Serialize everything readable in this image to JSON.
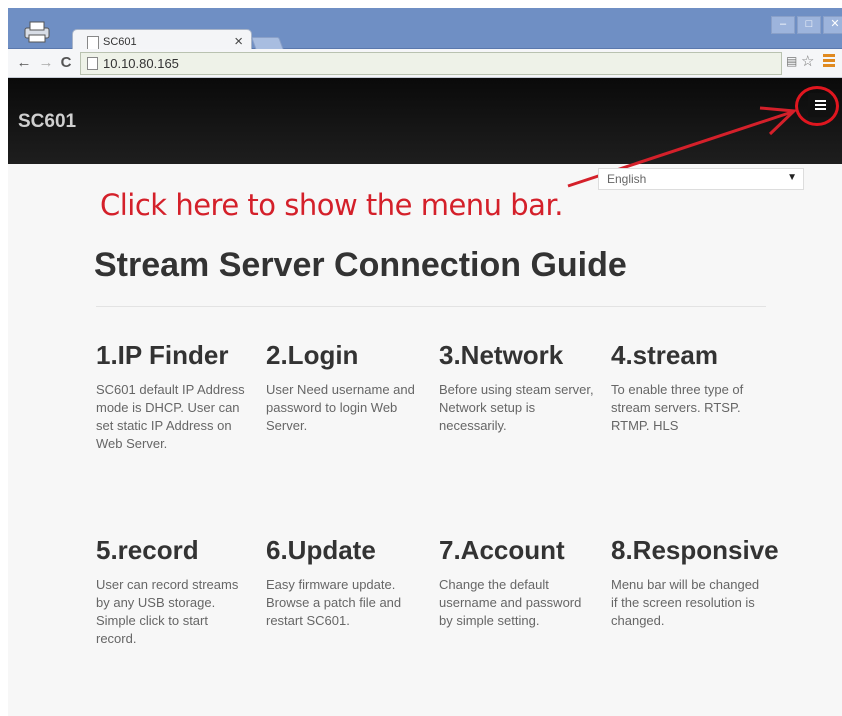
{
  "browser": {
    "tab_title": "SC601",
    "tab_close": "×",
    "url": "10.10.80.165",
    "back": "←",
    "forward": "→",
    "reload": "C",
    "win_min": "–",
    "win_max": "□",
    "win_close": "✕"
  },
  "navbar": {
    "brand": "SC601"
  },
  "language": {
    "selected": "English"
  },
  "annotation": {
    "text": "Click here to show the menu bar.",
    "color": "#d4202a"
  },
  "main": {
    "title": "Stream Server Connection Guide",
    "steps": [
      {
        "heading": "1.IP Finder",
        "text": "SC601 default IP Address mode is DHCP. User can set static IP Address on Web Server."
      },
      {
        "heading": "2.Login",
        "text": "User Need username and password to login Web Server."
      },
      {
        "heading": "3.Network",
        "text": "Before using steam server, Network setup is necessarily."
      },
      {
        "heading": "4.stream",
        "text": "To enable three type of stream servers. RTSP. RTMP. HLS"
      },
      {
        "heading": "5.record",
        "text": "User can record streams by any USB storage. Simple click to start record."
      },
      {
        "heading": "6.Update",
        "text": "Easy firmware update. Browse a patch file and restart SC601."
      },
      {
        "heading": "7.Account",
        "text": "Change the default username and password by simple setting."
      },
      {
        "heading": "8.Responsive",
        "text": "Menu bar will be changed if the screen resolution is changed."
      }
    ]
  }
}
